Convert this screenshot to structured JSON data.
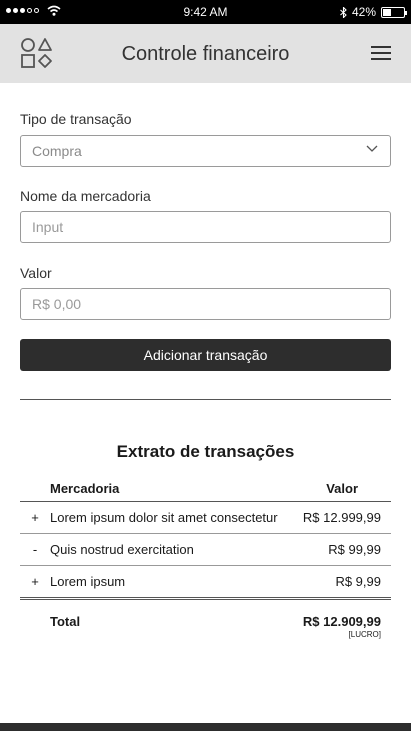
{
  "status_bar": {
    "time": "9:42 AM",
    "battery_text": "42%",
    "battery_level": 0.42,
    "signal_bars_filled": 3,
    "signal_bars_total": 5
  },
  "header": {
    "title": "Controle financeiro"
  },
  "form": {
    "transaction_type": {
      "label": "Tipo de transação",
      "selected": "Compra"
    },
    "merchandise": {
      "label": "Nome da mercadoria",
      "placeholder": "Input"
    },
    "value": {
      "label": "Valor",
      "placeholder": "R$ 0,00"
    },
    "submit_label": "Adicionar transação"
  },
  "statement": {
    "title": "Extrato de transações",
    "columns": {
      "item": "Mercadoria",
      "value": "Valor"
    },
    "rows": [
      {
        "sign": "+",
        "item": "Lorem ipsum dolor sit amet consectetur",
        "value": "R$ 12.999,99"
      },
      {
        "sign": "-",
        "item": "Quis nostrud exercitation",
        "value": "R$ 99,99"
      },
      {
        "sign": "+",
        "item": "Lorem ipsum",
        "value": "R$ 9,99"
      }
    ],
    "total": {
      "label": "Total",
      "value": "R$ 12.909,99",
      "status": "[LUCRO]"
    }
  }
}
